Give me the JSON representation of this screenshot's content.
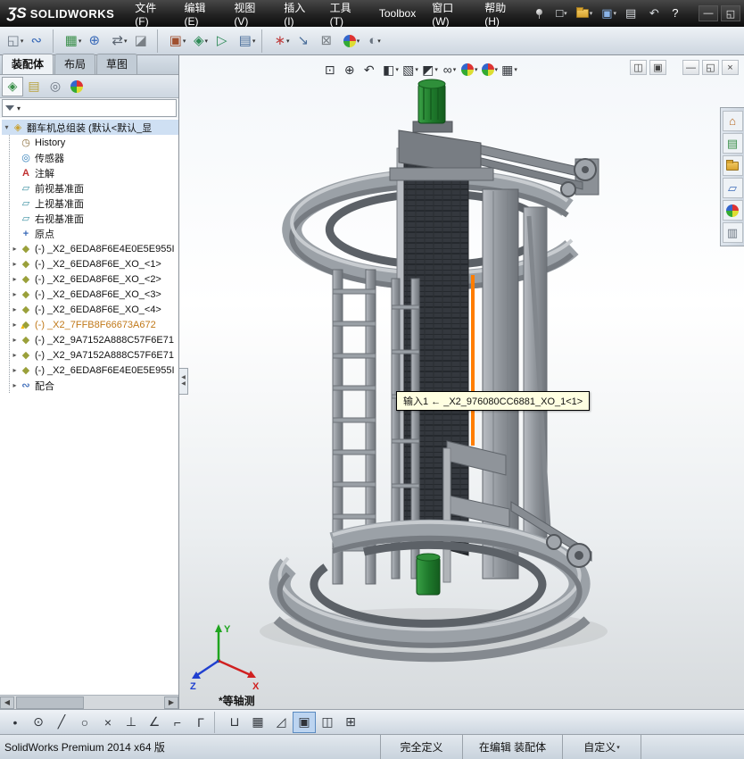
{
  "titlebar": {
    "logo_mark": "ƷS",
    "logo_text": "SOLIDWORKS",
    "menus": [
      {
        "name": "menu-file",
        "label": "文件(F)"
      },
      {
        "name": "menu-edit",
        "label": "编辑(E)"
      },
      {
        "name": "menu-view",
        "label": "视图(V)"
      },
      {
        "name": "menu-insert",
        "label": "插入(I)"
      },
      {
        "name": "menu-tools",
        "label": "工具(T)"
      },
      {
        "name": "menu-toolbox",
        "label": "Toolbox"
      },
      {
        "name": "menu-window",
        "label": "窗口(W)"
      },
      {
        "name": "menu-help",
        "label": "帮助(H)"
      }
    ],
    "quick_icons": [
      {
        "name": "new-document-icon",
        "glyph": "□",
        "color": "#f0f4f8",
        "dd": true
      },
      {
        "name": "open-icon",
        "glyph": "",
        "gk": "folder",
        "dd": true
      },
      {
        "name": "save-icon",
        "glyph": "▣",
        "color": "#8ab4e8",
        "dd": true
      },
      {
        "name": "print-icon",
        "glyph": "▤",
        "color": "#d8dce0",
        "dd": false
      },
      {
        "name": "undo-icon",
        "glyph": "↶",
        "color": "#d8dce0",
        "dd": false
      },
      {
        "name": "help-icon",
        "glyph": "?",
        "color": "#ffffff",
        "dd": false
      }
    ],
    "window_buttons": [
      {
        "name": "minimize-button",
        "glyph": "—"
      },
      {
        "name": "maximize-button",
        "glyph": "◱"
      }
    ]
  },
  "assembly_toolbar": {
    "items": [
      {
        "name": "insert-components-icon",
        "glyph": "◱",
        "color": "#6f7a86",
        "dd": true
      },
      {
        "name": "mate-icon",
        "glyph": "∾",
        "color": "#3a6ab8",
        "dd": false
      },
      {
        "name": "separator",
        "kind": "sep",
        "glyph": ""
      },
      {
        "name": "linear-component-pattern-icon",
        "glyph": "▦",
        "color": "#3a8f4a",
        "dd": true
      },
      {
        "name": "smart-fasteners-icon",
        "glyph": "⊕",
        "color": "#3a6ab8",
        "dd": false
      },
      {
        "name": "move-component-icon",
        "glyph": "⇄",
        "color": "#5a6470",
        "dd": true
      },
      {
        "name": "show-hidden-components-icon",
        "glyph": "◪",
        "color": "#7a8086",
        "dd": false
      },
      {
        "name": "separator",
        "kind": "sep",
        "glyph": ""
      },
      {
        "name": "assembly-features-icon",
        "glyph": "▣",
        "color": "#a05030",
        "dd": true
      },
      {
        "name": "reference-geometry-icon",
        "glyph": "◈",
        "color": "#2e8b57",
        "dd": true
      },
      {
        "name": "new-motion-study-icon",
        "glyph": "▷",
        "color": "#2e8b57",
        "dd": false
      },
      {
        "name": "bill-of-materials-icon",
        "glyph": "▤",
        "color": "#4a6e9a",
        "dd": true
      },
      {
        "name": "separator",
        "kind": "sep",
        "glyph": ""
      },
      {
        "name": "exploded-view-icon",
        "glyph": "∗",
        "color": "#c04040",
        "dd": true
      },
      {
        "name": "instant-3d-icon",
        "glyph": "↘",
        "color": "#4a6e9a",
        "dd": false
      },
      {
        "name": "interference-detection-icon",
        "glyph": "⊠",
        "color": "#7a8086",
        "dd": false
      },
      {
        "name": "edit-appearance-icon",
        "glyph": "",
        "gk": "ball",
        "dd": true
      },
      {
        "name": "apply-scene-icon",
        "glyph": "◐",
        "color": "#6a7480",
        "dd": true
      }
    ]
  },
  "command_tabs": {
    "items": [
      {
        "name": "tab-assembly",
        "label": "装配体",
        "active": true
      },
      {
        "name": "tab-layout",
        "label": "布局",
        "active": false
      },
      {
        "name": "tab-sketch",
        "label": "草图",
        "active": false
      }
    ]
  },
  "panel": {
    "tabs": [
      {
        "name": "featuremanager-tab-icon",
        "glyph": "◈",
        "color": "#3a8f4a",
        "active": true
      },
      {
        "name": "propertymanager-tab-icon",
        "glyph": "▤",
        "color": "#b8a23a",
        "active": false
      },
      {
        "name": "configurationmanager-tab-icon",
        "glyph": "◎",
        "color": "#6a7480",
        "active": false
      },
      {
        "name": "displaymanager-tab-icon",
        "glyph": "",
        "gk": "ball",
        "active": false
      }
    ],
    "overflow": "»",
    "tree_root": "翻车机总组装 (默认<默认_显",
    "tree_items": [
      {
        "name": "history-folder-icon",
        "label": "History",
        "icon": "ti-history",
        "expand": false
      },
      {
        "name": "sensors-icon",
        "label": "传感器",
        "icon": "ti-sensors",
        "expand": false
      },
      {
        "name": "annotations-icon",
        "label": "注解",
        "icon": "ti-ann",
        "expand": false
      },
      {
        "name": "plane-icon",
        "label": "前视基准面",
        "icon": "ti-plane",
        "expand": false
      },
      {
        "name": "plane-icon",
        "label": "上视基准面",
        "icon": "ti-plane",
        "expand": false
      },
      {
        "name": "plane-icon",
        "label": "右视基准面",
        "icon": "ti-plane",
        "expand": false
      },
      {
        "name": "origin-icon",
        "label": "原点",
        "icon": "ti-origin",
        "expand": false
      },
      {
        "name": "component-icon",
        "label": "(-) _X2_6EDA8F6E4E0E5E955I",
        "icon": "ti-comp",
        "expand": true
      },
      {
        "name": "component-icon",
        "label": "(-) _X2_6EDA8F6E_XO_<1>",
        "icon": "ti-comp",
        "expand": true
      },
      {
        "name": "component-icon",
        "label": "(-) _X2_6EDA8F6E_XO_<2>",
        "icon": "ti-comp",
        "expand": true
      },
      {
        "name": "component-icon",
        "label": "(-) _X2_6EDA8F6E_XO_<3>",
        "icon": "ti-comp",
        "expand": true
      },
      {
        "name": "component-icon",
        "label": "(-) _X2_6EDA8F6E_XO_<4>",
        "icon": "ti-comp",
        "expand": true
      },
      {
        "name": "component-warning-icon",
        "label": "(-) _X2_7FFB8F66673A672",
        "icon": "ti-compwarn",
        "expand": true,
        "warn": "warn"
      },
      {
        "name": "component-icon",
        "label": "(-) _X2_9A7152A888C57F6E71",
        "icon": "ti-comp",
        "expand": true
      },
      {
        "name": "component-icon",
        "label": "(-) _X2_9A7152A888C57F6E71",
        "icon": "ti-comp",
        "expand": true
      },
      {
        "name": "component-icon",
        "label": "(-) _X2_6EDA8F6E4E0E5E955I",
        "icon": "ti-comp",
        "expand": true
      },
      {
        "name": "mates-icon",
        "label": "配合",
        "icon": "ti-mates",
        "expand": true
      }
    ]
  },
  "viewport": {
    "view_toolbar": [
      {
        "name": "zoom-to-fit-icon",
        "glyph": "⊡",
        "dd": false
      },
      {
        "name": "zoom-to-area-icon",
        "glyph": "⊕",
        "dd": false
      },
      {
        "name": "previous-view-icon",
        "glyph": "↶",
        "dd": false
      },
      {
        "name": "section-view-icon",
        "glyph": "◧",
        "dd": true
      },
      {
        "name": "view-orientation-icon",
        "glyph": "▧",
        "dd": true
      },
      {
        "name": "display-style-icon",
        "glyph": "◩",
        "dd": true
      },
      {
        "name": "hide-show-items-icon",
        "glyph": "∞",
        "dd": true
      },
      {
        "name": "edit-appearance-icon",
        "glyph": "",
        "gk": "ball",
        "dd": true
      },
      {
        "name": "apply-scene-icon",
        "glyph": "",
        "gk": "ball",
        "dd": true
      },
      {
        "name": "view-settings-icon",
        "glyph": "▦",
        "dd": true
      }
    ],
    "window_controls": [
      {
        "name": "tile-window-icon",
        "glyph": "◫"
      },
      {
        "name": "cascade-window-icon",
        "glyph": "▣"
      },
      {
        "name": "minimize-window-icon",
        "glyph": "—",
        "gap": "gap"
      },
      {
        "name": "restore-window-icon",
        "glyph": "◱"
      },
      {
        "name": "close-window-icon",
        "glyph": "×"
      }
    ],
    "tooltip": "输入1  ←  _X2_976080CC6881_XO_1<1>",
    "view_label": "*等轴测",
    "triad": {
      "x": "X",
      "y": "Y",
      "z": "Z"
    },
    "highlight_color": "#ff7d00"
  },
  "taskpane": {
    "items": [
      {
        "name": "solidworks-resources-icon",
        "glyph": "⌂",
        "color": "#b5651d"
      },
      {
        "name": "design-library-icon",
        "glyph": "▤",
        "color": "#3a8f4a"
      },
      {
        "name": "file-explorer-icon",
        "glyph": "",
        "gk": "folder"
      },
      {
        "name": "view-palette-icon",
        "glyph": "▱",
        "color": "#3a6ab8"
      },
      {
        "name": "appearances-icon",
        "glyph": "",
        "gk": "ball"
      },
      {
        "name": "custom-properties-icon",
        "glyph": "▥",
        "color": "#6a7480"
      }
    ]
  },
  "sketch_toolbar": {
    "items": [
      {
        "name": "select-icon",
        "glyph": "•"
      },
      {
        "name": "circle-tool-icon",
        "glyph": "⊙"
      },
      {
        "name": "line-tool-icon",
        "glyph": "╱"
      },
      {
        "name": "ellipse-tool-icon",
        "glyph": "○"
      },
      {
        "name": "trim-entities-icon",
        "glyph": "×"
      },
      {
        "name": "perpendicular-relation-icon",
        "glyph": "⊥"
      },
      {
        "name": "smart-dimension-icon",
        "glyph": "∠"
      },
      {
        "name": "corner-rectangle-icon",
        "glyph": "⌐"
      },
      {
        "name": "convert-entities-icon",
        "glyph": "Γ"
      },
      {
        "name": "separator",
        "kind": "sep",
        "glyph": ""
      },
      {
        "name": "straight-slot-icon",
        "glyph": "⊔"
      },
      {
        "name": "linear-sketch-pattern-icon",
        "glyph": "▦"
      },
      {
        "name": "sketch-chamfer-icon",
        "glyph": "◿"
      },
      {
        "name": "shaded-sketch-contours-icon",
        "glyph": "▣",
        "active": true
      },
      {
        "name": "mirror-entities-icon",
        "glyph": "◫"
      },
      {
        "name": "sketch-table-icon",
        "glyph": "⊞"
      }
    ]
  },
  "statusbar": {
    "product": "SolidWorks Premium 2014 x64 版",
    "define_state": "完全定义",
    "edit_state": "在编辑 装配体",
    "custom": "自定义"
  }
}
